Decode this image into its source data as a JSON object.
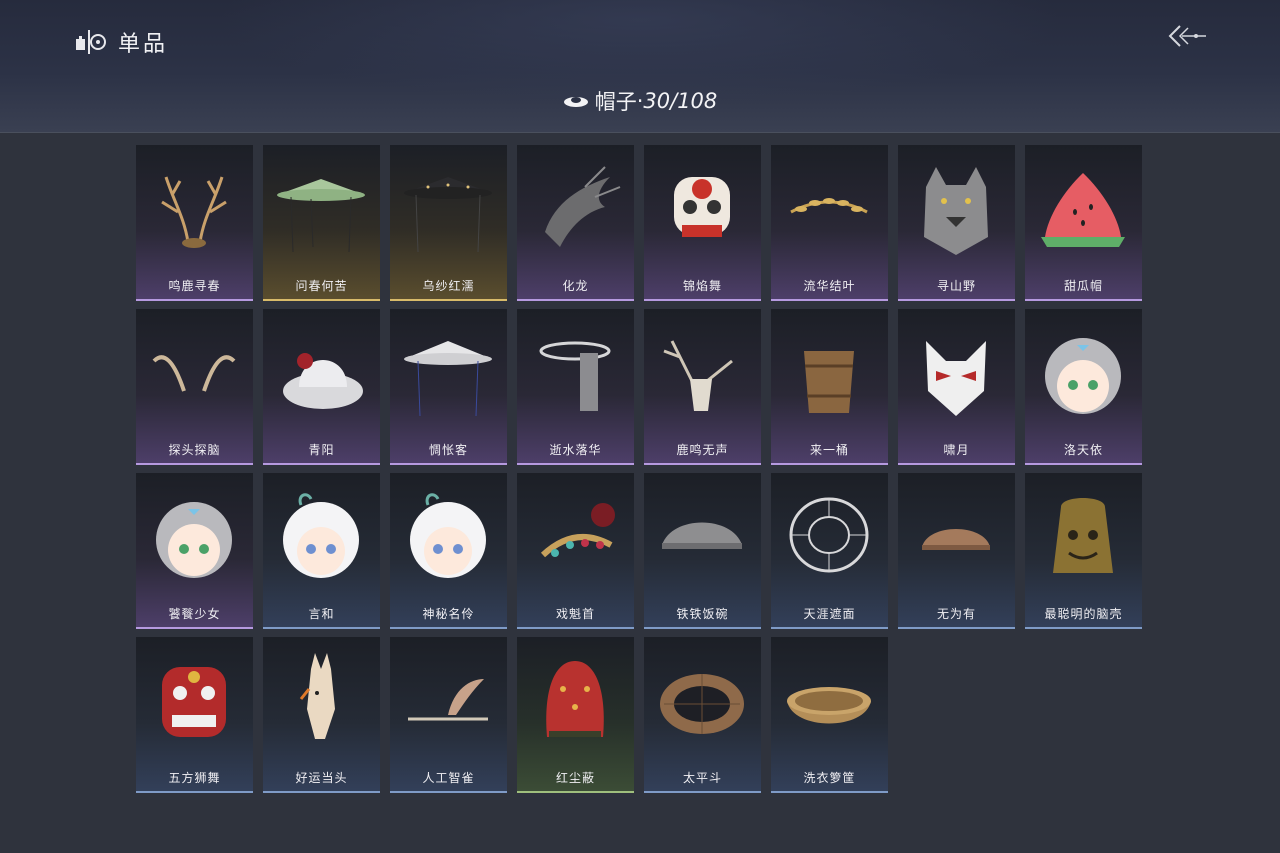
{
  "header": {
    "title": "单品",
    "category_label": "帽子",
    "separator": "·",
    "count": "30/108"
  },
  "items": [
    {
      "name": "鸣鹿寻春",
      "rarity": "purple",
      "icon": "antler-crown-icon"
    },
    {
      "name": "问春何苦",
      "rarity": "gold",
      "icon": "green-bamboo-hat-icon"
    },
    {
      "name": "乌纱红濡",
      "rarity": "gold",
      "icon": "black-veil-hat-icon"
    },
    {
      "name": "化龙",
      "rarity": "purple",
      "icon": "dragon-head-icon"
    },
    {
      "name": "锦焰舞",
      "rarity": "purple",
      "icon": "lion-dance-mask-icon"
    },
    {
      "name": "流华结叶",
      "rarity": "purple",
      "icon": "gold-leaf-circlet-icon"
    },
    {
      "name": "寻山野",
      "rarity": "purple",
      "icon": "wolf-head-icon"
    },
    {
      "name": "甜瓜帽",
      "rarity": "purple",
      "icon": "watermelon-hat-icon"
    },
    {
      "name": "探头探脑",
      "rarity": "purple",
      "icon": "feather-horns-icon"
    },
    {
      "name": "青阳",
      "rarity": "purple",
      "icon": "white-wide-hat-icon"
    },
    {
      "name": "惆怅客",
      "rarity": "purple",
      "icon": "white-bamboo-hat-icon"
    },
    {
      "name": "逝水落华",
      "rarity": "purple",
      "icon": "veil-headdress-icon"
    },
    {
      "name": "鹿鸣无声",
      "rarity": "purple",
      "icon": "deer-skull-icon"
    },
    {
      "name": "来一桶",
      "rarity": "purple",
      "icon": "wooden-bucket-icon"
    },
    {
      "name": "啸月",
      "rarity": "purple",
      "icon": "fox-mask-icon"
    },
    {
      "name": "洛天依",
      "rarity": "purple",
      "icon": "chibi-girl-head-icon"
    },
    {
      "name": "饕餮少女",
      "rarity": "purple",
      "icon": "chibi-girl-head-icon"
    },
    {
      "name": "言和",
      "rarity": "blue",
      "icon": "chibi-white-hair-head-icon"
    },
    {
      "name": "神秘名伶",
      "rarity": "blue",
      "icon": "chibi-white-hair-head-icon"
    },
    {
      "name": "戏魁首",
      "rarity": "blue",
      "icon": "opera-headdress-icon"
    },
    {
      "name": "铁铁饭碗",
      "rarity": "blue",
      "icon": "iron-bowl-icon"
    },
    {
      "name": "天涯遮面",
      "rarity": "blue",
      "icon": "wire-cage-hat-icon"
    },
    {
      "name": "无为有",
      "rarity": "blue",
      "icon": "clay-bowl-icon"
    },
    {
      "name": "最聪明的脑壳",
      "rarity": "blue",
      "icon": "bronze-bell-icon"
    },
    {
      "name": "五方狮舞",
      "rarity": "blue",
      "icon": "red-lion-mask-icon"
    },
    {
      "name": "好运当头",
      "rarity": "blue",
      "icon": "donkey-head-icon"
    },
    {
      "name": "人工智雀",
      "rarity": "blue",
      "icon": "bird-hairpin-icon"
    },
    {
      "name": "红尘蔽",
      "rarity": "green",
      "icon": "red-hood-icon"
    },
    {
      "name": "太平斗",
      "rarity": "blue",
      "icon": "woven-basket-hat-icon"
    },
    {
      "name": "洗衣箩筐",
      "rarity": "blue",
      "icon": "laundry-basket-icon"
    }
  ]
}
